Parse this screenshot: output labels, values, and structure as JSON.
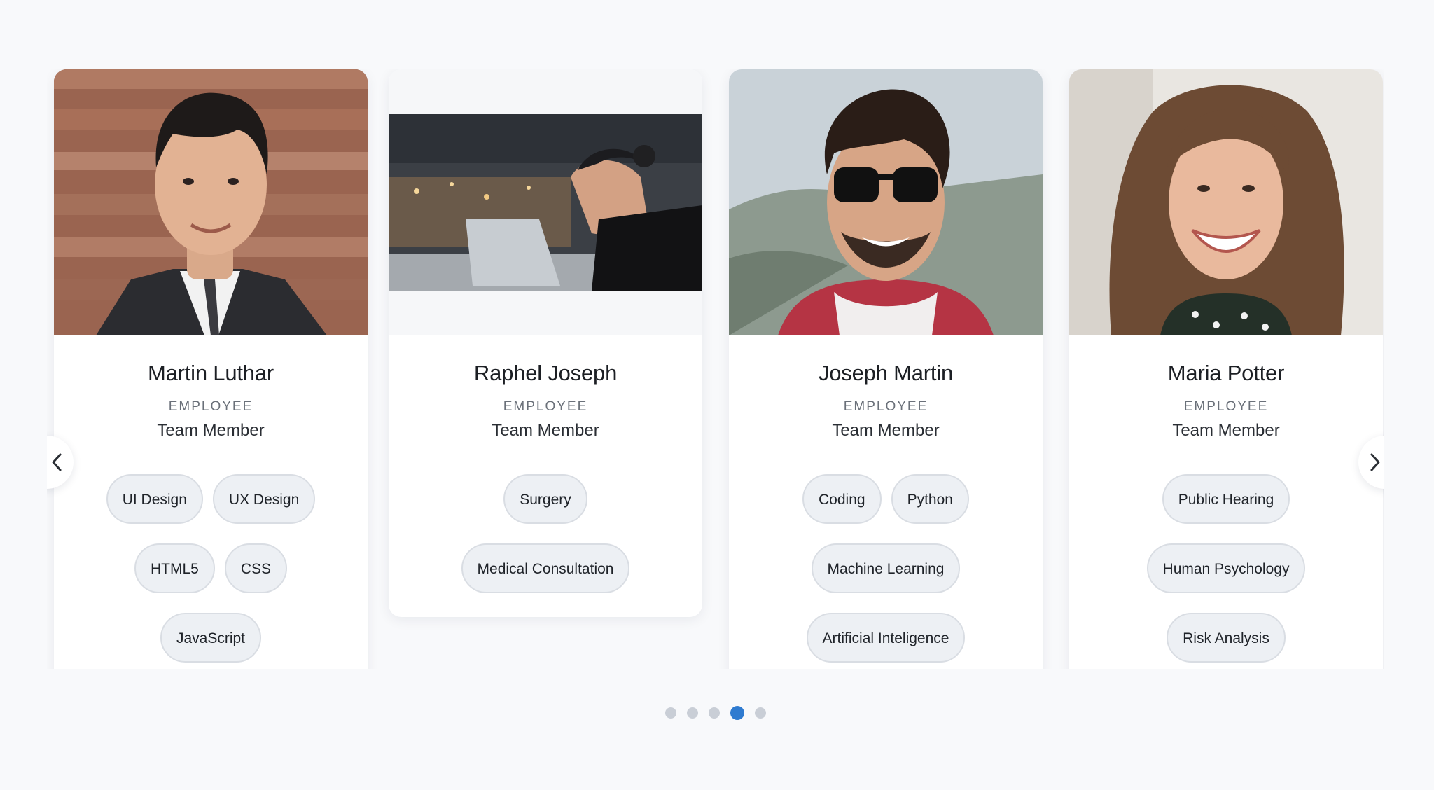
{
  "cards": [
    {
      "name": "Martin Luthar",
      "role": "EMPLOYEE",
      "title": "Team Member",
      "tags": [
        "UI Design",
        "UX Design",
        "HTML5",
        "CSS",
        "JavaScript"
      ]
    },
    {
      "name": "Raphel Joseph",
      "role": "EMPLOYEE",
      "title": "Team Member",
      "tags": [
        "Surgery",
        "Medical Consultation"
      ]
    },
    {
      "name": "Joseph Martin",
      "role": "EMPLOYEE",
      "title": "Team Member",
      "tags": [
        "Coding",
        "Python",
        "Machine Learning",
        "Artificial Inteligence"
      ]
    },
    {
      "name": "Maria Potter",
      "role": "EMPLOYEE",
      "title": "Team Member",
      "tags": [
        "Public Hearing",
        "Human Psychology",
        "Risk Analysis"
      ]
    }
  ],
  "navigation": {
    "prev_icon": "chevron-left-icon",
    "next_icon": "chevron-right-icon"
  },
  "pagination": {
    "total": 5,
    "active": 4
  },
  "colors": {
    "accent": "#2f7bd0",
    "page_background": "#f8f9fb",
    "tag_background": "#edf0f4"
  }
}
